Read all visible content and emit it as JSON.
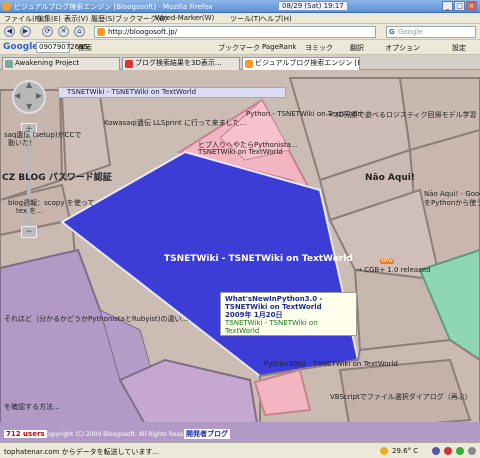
{
  "titlebar": {
    "title": "ビジュアルブログ検索エンジン [Bloogosoft] - Mozilla Firefox",
    "clock": "08/29 (Sat) 19:17",
    "min": "_",
    "max": "□",
    "close": "×"
  },
  "menu": {
    "items": [
      "ファイル(F)",
      "編集(E)",
      "表示(V)",
      "履歴(S)",
      "ブックマーク(B)",
      "Wired-Marker(W)",
      "ツール(T)",
      "ヘルプ(H)"
    ]
  },
  "nav": {
    "back": "◀",
    "forward": "▶",
    "reload": "⟳",
    "stop": "✕",
    "home": "⌂",
    "url": "http://bloogosoft.jp/",
    "search_placeholder": "Google"
  },
  "gbar": {
    "logo": "Google",
    "query": "09079072695",
    "items": [
      "検索",
      "ブックマーク",
      "PageRank",
      "ヨミック",
      "翻訳",
      "オプション",
      "設定"
    ]
  },
  "tabs": [
    {
      "label": "Awakening Project",
      "active": false
    },
    {
      "label": "ブログ検索結果を3D表示... ",
      "active": false
    },
    {
      "label": "ビジュアルブログ検索エンジン [Bloo...",
      "active": true
    }
  ],
  "map": {
    "breadcrumb": "TSNETWiki - TSNETWiki on TextWorld",
    "main_label": "TSNETWiki - TSNETWiki on TextWorld",
    "labels": [
      "Python - TSNETWiki on TextWorld",
      "Kowasaqi遺伝 LLSprint に行って来ました...",
      "ヒブ入りへやたらPythonista...",
      "TSNETWiki on TextWorld",
      "→ 3D元素で遊べるロジスティク回帰モデル学習",
      "Nāo Aqui!",
      "Nāo Aqui! - Google Search REST API",
      "をPythonから使う",
      "CZ BLOG パスワード認証",
      "blog週報：scopy を使って",
      "tex を...",
      "saq遺伝 (setup)がCCで",
      "動いた！",
      "→ CGB+ 1.0 released",
      "それほど（分かるかどうかPythonistaとRubyist)の違い...",
      "Python3000 - TSNETWiki on TextWorld",
      "VBScriptでファイル選択ダイアログ（再ぶ）",
      "を確認する方法..."
    ],
    "popup": {
      "title": "What'sNewInPython3.0 -",
      "title2": "TSNETWiki on TextWorld",
      "date": "2009年 1月20日",
      "source": "TSNETWiki - TSNETWiki on TextWorld"
    },
    "new_badge": "NEW",
    "users": "712 users",
    "copyright": "Copyright (C) 2009 Bloogosoft. All Rights Reserved.",
    "foot_link": "開発者ブログ"
  },
  "status": {
    "text": "tophatenar.com からデータを転送しています...",
    "temp": "29.6° C"
  },
  "colors": {
    "main_shape": "#3c3dd6",
    "highlight": "#f5b6c2",
    "cell": "#cfbfb8",
    "purple": "#b197c6",
    "green": "#8fd6b4"
  }
}
